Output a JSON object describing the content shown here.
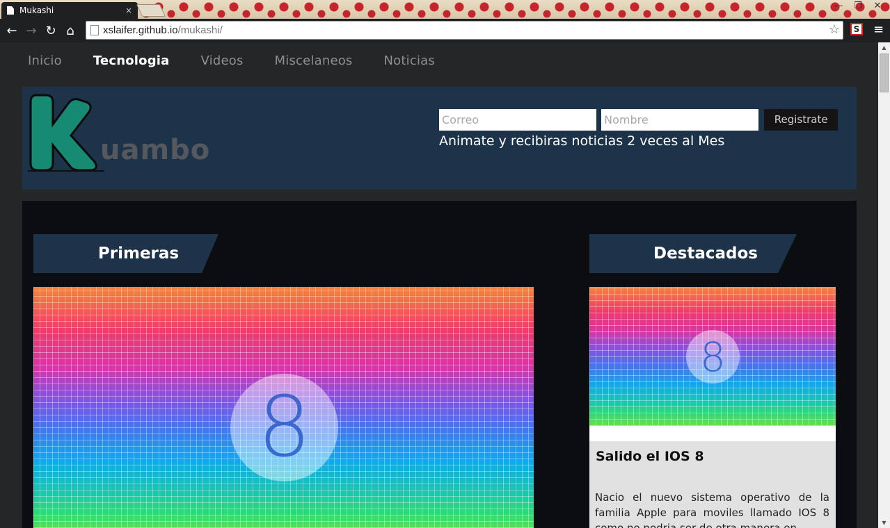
{
  "browser": {
    "tab_title": "Mukashi",
    "tab_close": "×",
    "url_host": "xslaifer.github.io",
    "url_path": "/mukashi/",
    "back_glyph": "←",
    "forward_glyph": "→",
    "reload_glyph": "↻",
    "home_glyph": "⌂",
    "star_glyph": "☆",
    "menu_glyph": "≡",
    "extension_glyph": "S",
    "window_minimize": "—",
    "window_restore": "❐",
    "window_close": "✕"
  },
  "nav": {
    "items": [
      {
        "label": "Inicio"
      },
      {
        "label": "Tecnologia"
      },
      {
        "label": "Videos"
      },
      {
        "label": "Miscelaneos"
      },
      {
        "label": "Noticias"
      }
    ],
    "active": "Tecnologia"
  },
  "logo": {
    "letter": "K",
    "text": "uambo"
  },
  "signup": {
    "email_placeholder": "Correo",
    "name_placeholder": "Nombre",
    "button_label": "Registrate",
    "note": "Animate y recibiras noticias 2 veces al Mes"
  },
  "sections": {
    "primeras_title": "Primeras",
    "destacados_title": "Destacados"
  },
  "images": {
    "main_badge": "8",
    "side_badge": "8"
  },
  "card": {
    "title": "Salido el IOS 8",
    "body": "Nacio el nuevo sistema operativo de la familia Apple para moviles llamado IOS 8 como no podria ser de otra manera en"
  },
  "colors": {
    "header_bg": "#1d3349",
    "page_bg": "#252627",
    "content_bg": "#0b0d10",
    "logo_k": "#168a72"
  }
}
